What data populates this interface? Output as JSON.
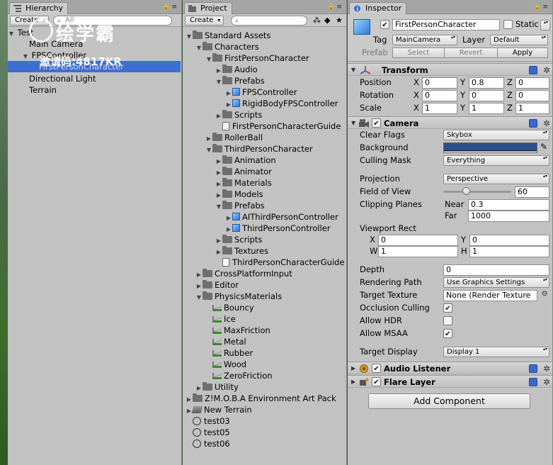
{
  "hierarchy": {
    "tab_label": "Hierarchy",
    "create_label": "Create",
    "search_placeholder": "All",
    "items": [
      {
        "label": "Test"
      },
      {
        "label": "Main Camera"
      },
      {
        "label": "FPSController"
      },
      {
        "label": "FirstPersonCharacter",
        "selected": true
      },
      {
        "label": "Directional Light"
      },
      {
        "label": "Terrain"
      }
    ]
  },
  "watermark": {
    "title": "绘学霸",
    "code": "邀请码:4817KR"
  },
  "project": {
    "tab_label": "Project",
    "create_label": "Create",
    "tree": [
      {
        "label": "Standard Assets"
      },
      {
        "label": "Characters"
      },
      {
        "label": "FirstPersonCharacter"
      },
      {
        "label": "Audio"
      },
      {
        "label": "Prefabs"
      },
      {
        "label": "FPSController"
      },
      {
        "label": "RigidBodyFPSController"
      },
      {
        "label": "Scripts"
      },
      {
        "label": "FirstPersonCharacterGuide"
      },
      {
        "label": "RollerBall"
      },
      {
        "label": "ThirdPersonCharacter"
      },
      {
        "label": "Animation"
      },
      {
        "label": "Animator"
      },
      {
        "label": "Materials"
      },
      {
        "label": "Models"
      },
      {
        "label": "Prefabs"
      },
      {
        "label": "AIThirdPersonController"
      },
      {
        "label": "ThirdPersonController"
      },
      {
        "label": "Scripts"
      },
      {
        "label": "Textures"
      },
      {
        "label": "ThirdPersonCharacterGuide"
      },
      {
        "label": "CrossPlatformInput"
      },
      {
        "label": "Editor"
      },
      {
        "label": "PhysicsMaterials"
      },
      {
        "label": "Bouncy"
      },
      {
        "label": "Ice"
      },
      {
        "label": "MaxFriction"
      },
      {
        "label": "Metal"
      },
      {
        "label": "Rubber"
      },
      {
        "label": "Wood"
      },
      {
        "label": "ZeroFriction"
      },
      {
        "label": "Utility"
      },
      {
        "label": "Z!M.O.B.A Environment Art Pack"
      },
      {
        "label": "New Terrain"
      },
      {
        "label": "test03"
      },
      {
        "label": "test05"
      },
      {
        "label": "test06"
      }
    ]
  },
  "inspector": {
    "tab_label": "Inspector",
    "object_name": "FirstPersonCharacter",
    "static_label": "Static",
    "tag_label": "Tag",
    "tag_value": "MainCamera",
    "layer_label": "Layer",
    "layer_value": "Default",
    "prefab_label": "Prefab",
    "select_label": "Select",
    "revert_label": "Revert",
    "apply_label": "Apply",
    "transform": {
      "title": "Transform",
      "position_label": "Position",
      "rotation_label": "Rotation",
      "scale_label": "Scale",
      "axis_x": "X",
      "axis_y": "Y",
      "axis_z": "Z",
      "position": {
        "x": "0",
        "y": "0.8",
        "z": "0"
      },
      "rotation": {
        "x": "0",
        "y": "0",
        "z": "0"
      },
      "scale": {
        "x": "1",
        "y": "1",
        "z": "1"
      }
    },
    "camera": {
      "title": "Camera",
      "clear_flags_label": "Clear Flags",
      "clear_flags_value": "Skybox",
      "background_label": "Background",
      "background_color": "#2c4f86",
      "culling_mask_label": "Culling Mask",
      "culling_mask_value": "Everything",
      "projection_label": "Projection",
      "projection_value": "Perspective",
      "fov_label": "Field of View",
      "fov_value": "60",
      "fov_fraction": 0.33,
      "clipping_label": "Clipping Planes",
      "near_label": "Near",
      "near_value": "0.3",
      "far_label": "Far",
      "far_value": "1000",
      "viewport_label": "Viewport Rect",
      "vp_x_label": "X",
      "vp_y_label": "Y",
      "vp_w_label": "W",
      "vp_h_label": "H",
      "vp_x": "0",
      "vp_y": "0",
      "vp_w": "1",
      "vp_h": "1",
      "depth_label": "Depth",
      "depth_value": "0",
      "rendering_path_label": "Rendering Path",
      "rendering_path_value": "Use Graphics Settings",
      "target_texture_label": "Target Texture",
      "target_texture_value": "None (Render Texture",
      "occlusion_label": "Occlusion Culling",
      "occlusion_checked": true,
      "hdr_label": "Allow HDR",
      "hdr_checked": false,
      "msaa_label": "Allow MSAA",
      "msaa_checked": true,
      "target_display_label": "Target Display",
      "target_display_value": "Display 1"
    },
    "audio_listener_title": "Audio Listener",
    "flare_layer_title": "Flare Layer",
    "add_component_label": "Add Component"
  }
}
